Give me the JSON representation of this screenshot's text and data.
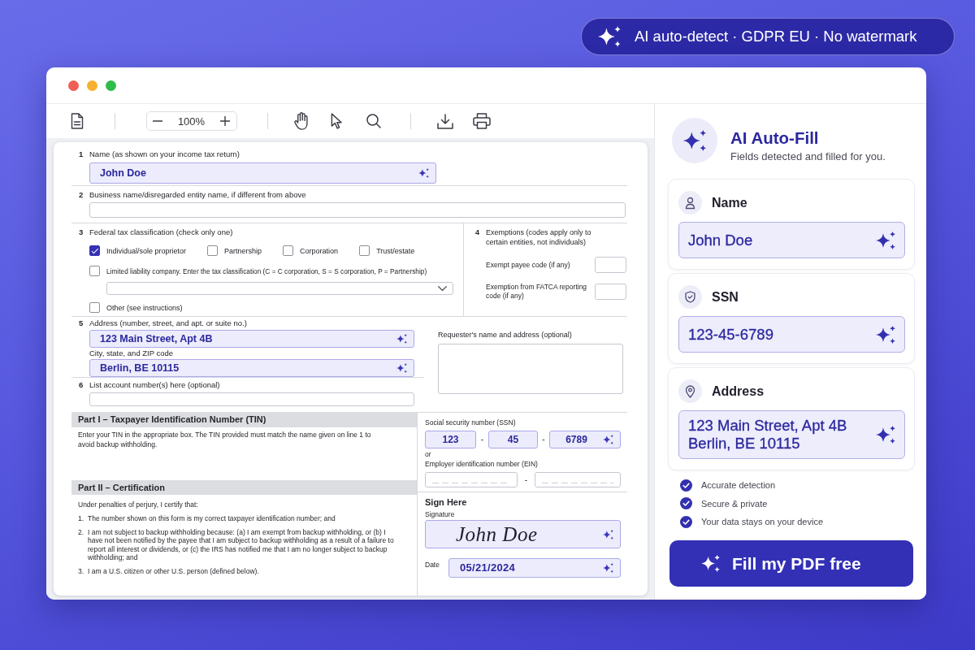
{
  "badge": {
    "text": "AI auto-detect · GDPR EU · No watermark"
  },
  "toolbar": {
    "zoom_level": "100%"
  },
  "form": {
    "name_line": {
      "number": "1",
      "label": "Name (as shown on your income tax return)",
      "field": {
        "value": "John Doe",
        "autofilled": true
      }
    },
    "business_line": {
      "number": "2",
      "label": "Business name/disregarded entity name, if different from above",
      "field": {
        "autofilled": false
      }
    },
    "classification": {
      "number": "3",
      "label": "Federal tax classification (check only one)",
      "options": [
        {
          "label": "Individual/sole proprietor",
          "checked": true
        },
        {
          "label": "Partnership",
          "checked": false
        },
        {
          "label": "Corporation",
          "checked": false
        },
        {
          "label": "Trust/estate",
          "checked": false
        }
      ],
      "llc": {
        "label": "Limited liability company. Enter the tax classification (C = C corporation, S = S corporation, P = Partnership)",
        "checked": false
      },
      "other": {
        "label": "Other (see instructions)",
        "checked": false
      }
    },
    "exemptions": {
      "number": "4",
      "label": "Exemptions (codes apply only to certain entities, not individuals)",
      "codes": [
        {
          "label": "Exempt payee code (if any)"
        },
        {
          "label": "Exemption from FATCA reporting code (if any)"
        }
      ]
    },
    "address": {
      "number": "5",
      "label": "Address (number, street, and apt. or suite no.)",
      "field": {
        "value": "123 Main Street, Apt 4B",
        "autofilled": true
      }
    },
    "city": {
      "label": "City, state, and ZIP code",
      "field": {
        "value": "Berlin, BE 10115",
        "autofilled": true
      }
    },
    "accounts": {
      "number": "6",
      "label": "List account number(s) here (optional)",
      "field": {
        "autofilled": false
      }
    },
    "requester": {
      "label": "Requester's name and address (optional)"
    },
    "part_1": {
      "title": "Part I – Taxpayer Identification Number (TIN)",
      "text": "Enter your TIN in the appropriate box. The TIN provided must match the name given on line 1 to avoid backup withholding."
    },
    "ssn": {
      "label": "Social security number (SSN)",
      "segments": [
        {
          "value": "123",
          "autofilled": true
        },
        {
          "value": "45",
          "autofilled": true
        },
        {
          "value": "6789",
          "autofilled": true
        }
      ],
      "separators": [
        "-",
        "-"
      ]
    },
    "or_text": "or",
    "ein": {
      "label": "Employer identification number (EIN)",
      "segments": [
        {
          "autofilled": false
        },
        {
          "autofilled": false
        }
      ],
      "separators": [
        "-"
      ]
    },
    "part_2": {
      "title": "Part II – Certification",
      "intro": "Under penalties of perjury, I certify that:",
      "items": [
        {
          "number": "1.",
          "text": "The number shown on this form is my correct taxpayer identification number; and"
        },
        {
          "number": "2.",
          "text": "I am not subject to backup withholding because: (a) I am exempt from backup withholding, or (b) I have not been notified by the payee that I am subject to backup withholding as a result of a failure to report all interest or dividends, or (c) the IRS has notified me that I am no longer subject to backup withholding; and"
        },
        {
          "number": "3.",
          "text": "I am a U.S. citizen or other U.S. person (defined below)."
        }
      ]
    },
    "sign": {
      "title": "Sign Here",
      "signature": {
        "label": "Signature",
        "value": "John Doe",
        "autofilled": true
      },
      "date": {
        "label": "Date",
        "value": "05/21/2024",
        "autofilled": true
      }
    }
  },
  "panel": {
    "title": "AI Auto-Fill",
    "subtitle": "Fields detected and filled for you.",
    "cards": [
      {
        "label": "Name",
        "value": "John Doe"
      },
      {
        "label": "SSN",
        "value": "123-45-6789"
      },
      {
        "label": "Address",
        "value": "123 Main Street, Apt 4B\nBerlin, BE 10115"
      }
    ],
    "features": [
      "Accurate detection",
      "Secure & private",
      "Your data stays on your device"
    ],
    "button": "Fill my PDF free"
  }
}
